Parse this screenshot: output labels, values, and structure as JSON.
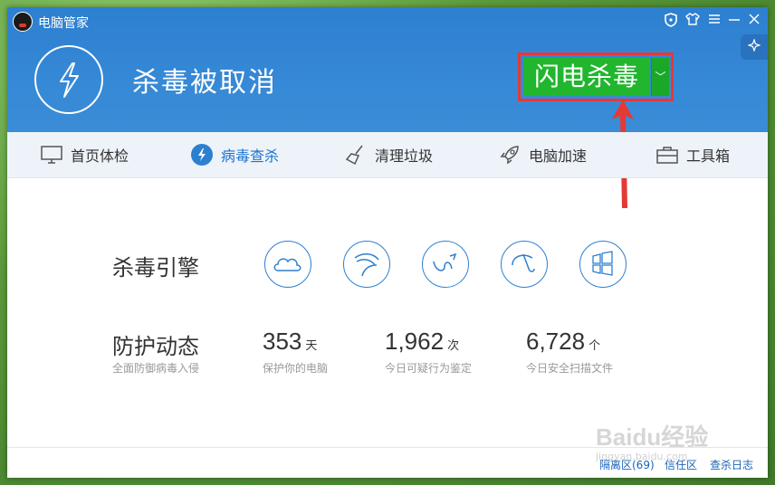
{
  "app": {
    "title": "电脑管家"
  },
  "titlebar": {
    "shield_icon": "shield-icon",
    "skin_icon": "tshirt-icon",
    "menu_icon": "menu-icon",
    "minimize_icon": "minimize-icon",
    "close_icon": "close-icon"
  },
  "header": {
    "status_title": "杀毒被取消",
    "scan_button_label": "闪电杀毒",
    "scan_dropdown_glyph": "﹀"
  },
  "nav": {
    "items": [
      {
        "label": "首页体检",
        "icon": "monitor-icon"
      },
      {
        "label": "病毒查杀",
        "icon": "lightning-icon"
      },
      {
        "label": "清理垃圾",
        "icon": "broom-icon"
      },
      {
        "label": "电脑加速",
        "icon": "rocket-icon"
      },
      {
        "label": "工具箱",
        "icon": "toolbox-icon"
      }
    ]
  },
  "engine": {
    "label": "杀毒引擎",
    "icons": [
      "cloud-engine-icon",
      "eagle-engine-icon",
      "curve-engine-icon",
      "umbrella-engine-icon",
      "windows-engine-icon"
    ]
  },
  "defense": {
    "title": "防护动态",
    "subtitle": "全面防御病毒入侵",
    "stats": [
      {
        "value": "353",
        "unit": "天",
        "desc": "保护你的电脑"
      },
      {
        "value": "1,962",
        "unit": "次",
        "desc": "今日可疑行为鉴定"
      },
      {
        "value": "6,728",
        "unit": "个",
        "desc": "今日安全扫描文件"
      }
    ]
  },
  "footer": {
    "links": [
      "隔离区(69)",
      "信任区",
      "查杀日志"
    ]
  },
  "watermark": {
    "text": "Baidu经验",
    "sub": "jingyan.baidu.com"
  },
  "colors": {
    "header_blue": "#2d7fd0",
    "scan_green": "#21b62e",
    "highlight_red": "#e53935",
    "accent_blue": "#1a73d0"
  }
}
